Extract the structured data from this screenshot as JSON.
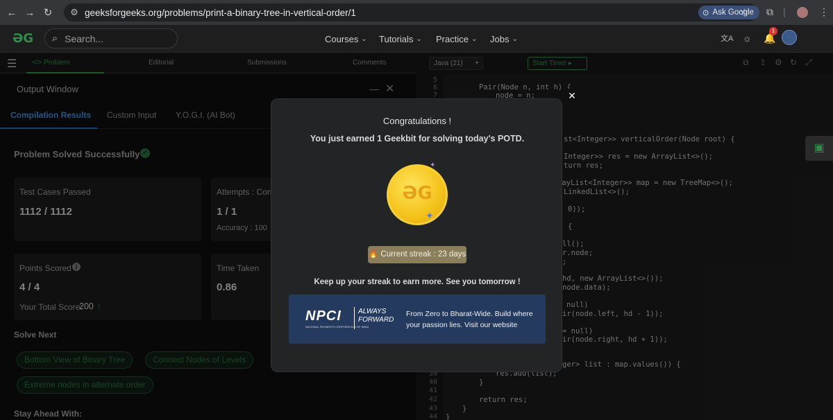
{
  "browser": {
    "url": "geeksforgeeks.org/problems/print-a-binary-tree-in-vertical-order/1",
    "ask_google": "Ask Google"
  },
  "header": {
    "search_placeholder": "Search...",
    "menu": [
      "Courses",
      "Tutorials",
      "Practice",
      "Jobs"
    ],
    "notification_count": "1"
  },
  "left": {
    "tabs": [
      "</> Problem",
      "Editorial",
      "Submissions",
      "Comments"
    ],
    "output_title": "Output Window",
    "subtabs": [
      "Compilation Results",
      "Custom Input",
      "Y.O.G.I. (AI Bot)"
    ],
    "status": "Problem Solved Successfully",
    "cards": {
      "tests_label": "Test Cases Passed",
      "tests_value": "1112 / 1112",
      "attempts_label": "Attempts : Corr",
      "attempts_value": "1 / 1",
      "accuracy_label": "Accuracy : 100",
      "points_label": "Points Scored",
      "points_value": "4 / 4",
      "total_label": "Your Total Score:",
      "total_value": "200",
      "time_label": "Time Taken",
      "time_value": "0.86"
    },
    "solve_next_title": "Solve Next",
    "solve_next": [
      "Bottom View of Binary Tree",
      "Connect Nodes of Levels",
      "Extreme nodes in alternate order"
    ],
    "stay_ahead": "Stay Ahead With:"
  },
  "editor": {
    "language": "Java (21)",
    "timer": "Start Timer",
    "line_numbers": [
      "5",
      "6",
      "7",
      "39",
      "40",
      "41",
      "42",
      "43",
      "44"
    ],
    "code_lines": [
      "Pair(Node n, int h) {",
      "node = n;",
      "st<Integer>> verticalOrder(Node root) {",
      "Integer>> res = new ArrayList<>();",
      "turn res;",
      "rayList<Integer>> map = new TreeMap<>();",
      "LinkedList<>();",
      "0));",
      "{",
      "ll();",
      "r.node;",
      ";",
      "hd, new ArrayList<>());",
      "node.data);",
      "null)",
      "ir(node.left, hd - 1));",
      "= null)",
      "ir(node.right, hd + 1));",
      "ger> list : map.values()) {",
      "res.add(list);",
      "}",
      "return res;",
      "}",
      "}"
    ]
  },
  "modal": {
    "title": "Congratulations !",
    "subtitle": "You just earned 1 Geekbit for solving today's POTD.",
    "streak": "Current streak : 23 days",
    "keep": "Keep up your streak to earn more. See you tomorrow !",
    "banner_brand": "NPCI",
    "banner_brand_sub": "NATIONAL PAYMENTS CORPORATION OF INDIA",
    "banner_tag_1": "ALWAYS",
    "banner_tag_2": "FORWARD",
    "banner_text": "From Zero to Bharat-Wide. Build where your passion lies. Visit our website"
  }
}
